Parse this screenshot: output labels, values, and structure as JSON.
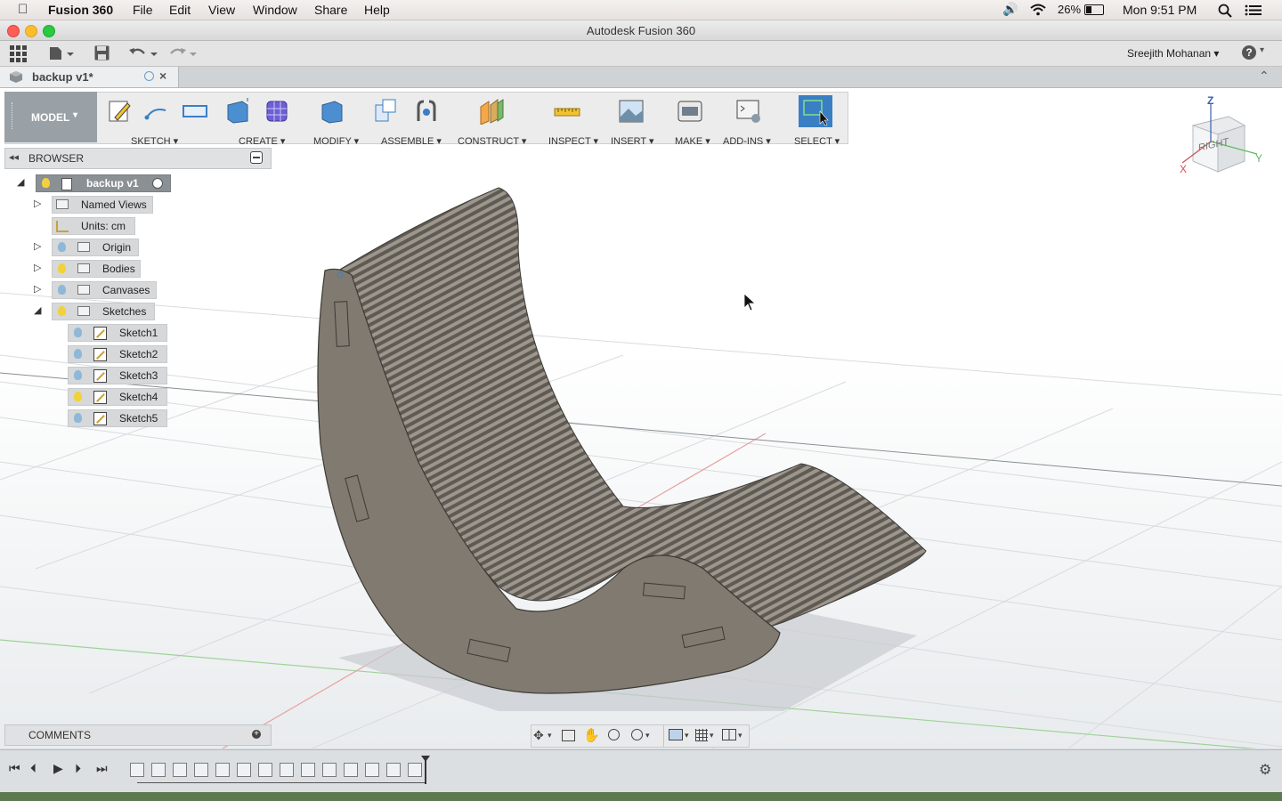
{
  "menubar": {
    "app_name": "Fusion 360",
    "items": [
      "File",
      "Edit",
      "View",
      "Window",
      "Share",
      "Help"
    ],
    "battery": "26%",
    "clock": "Mon 9:51 PM"
  },
  "window": {
    "title": "Autodesk Fusion 360"
  },
  "qat": {
    "user": "Sreejith Mohanan ▾",
    "help": "?"
  },
  "document": {
    "tab_label": "backup v1*"
  },
  "ribbon": {
    "workspace": "MODEL",
    "groups": [
      {
        "label": "SKETCH ▾"
      },
      {
        "label": "CREATE ▾"
      },
      {
        "label": "MODIFY ▾"
      },
      {
        "label": "ASSEMBLE ▾"
      },
      {
        "label": "CONSTRUCT ▾"
      },
      {
        "label": "INSPECT ▾"
      },
      {
        "label": "INSERT ▾"
      },
      {
        "label": "MAKE ▾"
      },
      {
        "label": "ADD-INS ▾"
      },
      {
        "label": "SELECT ▾"
      }
    ]
  },
  "viewcube": {
    "face": "RIGHT",
    "axis_z": "Z",
    "axis_x": "X",
    "axis_y": "Y"
  },
  "browser": {
    "title": "BROWSER",
    "root": "backup v1",
    "nodes": [
      {
        "label": "Named Views"
      },
      {
        "label": "Units: cm"
      },
      {
        "label": "Origin"
      },
      {
        "label": "Bodies"
      },
      {
        "label": "Canvases"
      },
      {
        "label": "Sketches"
      }
    ],
    "sketches": [
      "Sketch1",
      "Sketch2",
      "Sketch3",
      "Sketch4",
      "Sketch5"
    ]
  },
  "comments": {
    "title": "COMMENTS"
  },
  "colors": {
    "accent": "#3a7fc4",
    "bulb_on": "#f2d13a",
    "bulb_off": "#8fb8d8",
    "model_body": "#807a70",
    "select_active": "#3a7fc4"
  }
}
